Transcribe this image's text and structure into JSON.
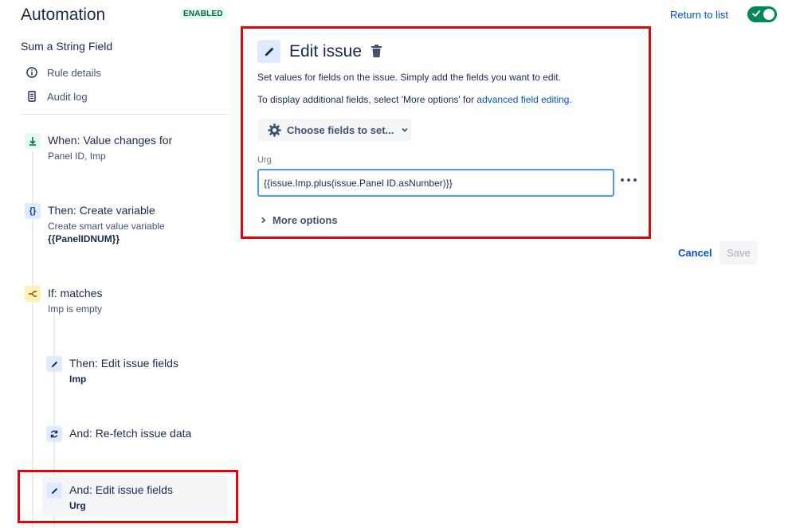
{
  "header": {
    "title": "Automation",
    "status_badge": "ENABLED",
    "return_link": "Return to list",
    "toggle_on": true
  },
  "sidebar": {
    "rule_name": "Sum a String Field",
    "links": [
      {
        "label": "Rule details",
        "icon": "info-icon"
      },
      {
        "label": "Audit log",
        "icon": "document-icon"
      }
    ],
    "steps": [
      {
        "title": "When: Value changes for",
        "subtitle": "Panel ID, Imp",
        "icon": "trigger-icon"
      },
      {
        "title": "Then: Create variable",
        "subtitle": "Create smart value variable",
        "detail": "{{PanelIDNUM}}",
        "icon": "variable-icon"
      },
      {
        "title": "If: matches",
        "subtitle": "Imp is empty",
        "icon": "branch-icon"
      },
      {
        "title": "Then: Edit issue fields",
        "detail": "Imp",
        "icon": "pencil-icon"
      },
      {
        "title": "And: Re-fetch issue data",
        "icon": "refresh-icon"
      },
      {
        "title": "And: Edit issue fields",
        "detail": "Urg",
        "icon": "pencil-icon",
        "selected": true
      }
    ]
  },
  "panel": {
    "title": "Edit issue",
    "description": "Set values for fields on the issue. Simply add the fields you want to edit.",
    "additional_text": "To display additional fields, select 'More options' for ",
    "additional_link": "advanced field editing",
    "additional_suffix": ".",
    "choose_fields_button": "Choose fields to set...",
    "field": {
      "label": "Urg",
      "value": "{{issue.Imp.plus(issue.Panel ID.asNumber)}}"
    },
    "more_options": "More options"
  },
  "actions": {
    "cancel": "Cancel",
    "save": "Save"
  },
  "colors": {
    "accent": "#0052cc",
    "highlight_border": "#e0050a",
    "toggle": "#00875a"
  }
}
